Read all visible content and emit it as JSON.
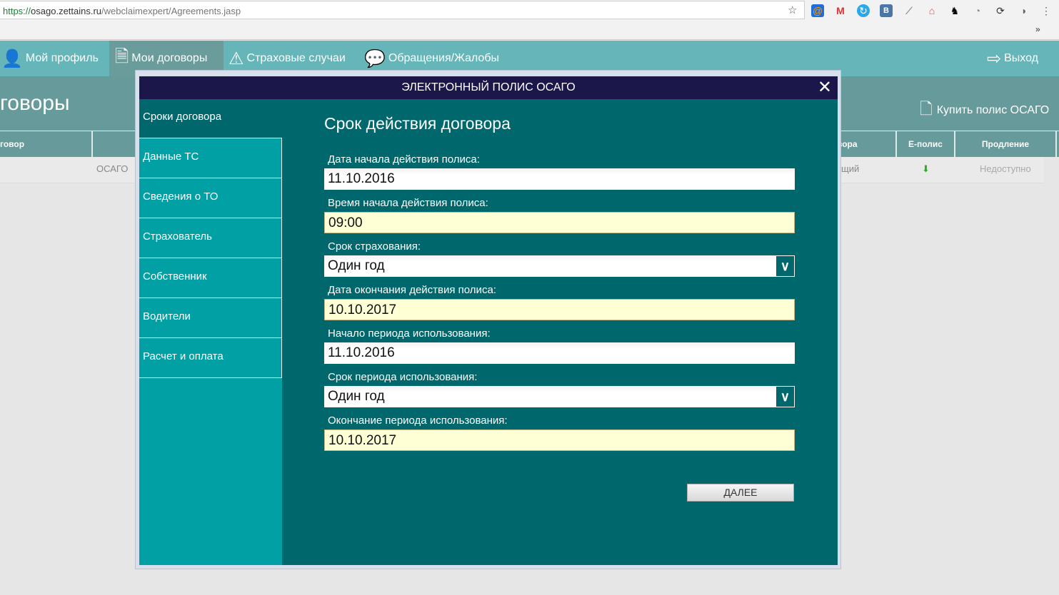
{
  "browser": {
    "url_scheme": "https://",
    "url_host": "osago.zettains.ru",
    "url_path": "/webclaimexpert/Agreements.jasp",
    "overflow": "»"
  },
  "nav": {
    "items": [
      {
        "label": "Мой профиль"
      },
      {
        "label": "Мои договоры"
      },
      {
        "label": "Страховые случаи"
      },
      {
        "label": "Обращения/Жалобы"
      }
    ],
    "logout": "Выход"
  },
  "page": {
    "title": "говоры",
    "buy": "Купить полис ОСАГО",
    "columns": [
      "говор",
      "вора",
      "Е-полис",
      "Продление"
    ],
    "row": {
      "type": "ОСАГО",
      "status": "щий",
      "renewal": "Недоступно"
    }
  },
  "modal": {
    "title": "ЭЛЕКТРОННЫЙ ПОЛИС ОСАГО",
    "steps": [
      "Сроки договора",
      "Данные ТС",
      "Сведения о ТО",
      "Страхователь",
      "Собственник",
      "Водители",
      "Расчет и оплата"
    ],
    "heading": "Срок действия договора",
    "fields": [
      {
        "label": "Дата начала действия полиса:",
        "value": "11.10.2016"
      },
      {
        "label": "Время начала действия полиса:",
        "value": "09:00"
      },
      {
        "label": "Срок страхования:",
        "value": "Один год"
      },
      {
        "label": "Дата окончания действия полиса:",
        "value": "10.10.2017"
      },
      {
        "label": "Начало периода использования:",
        "value": "11.10.2016"
      },
      {
        "label": "Срок периода использования:",
        "value": "Один год"
      },
      {
        "label": "Окончание периода использования:",
        "value": "10.10.2017"
      }
    ],
    "next": "ДАЛЕЕ"
  }
}
